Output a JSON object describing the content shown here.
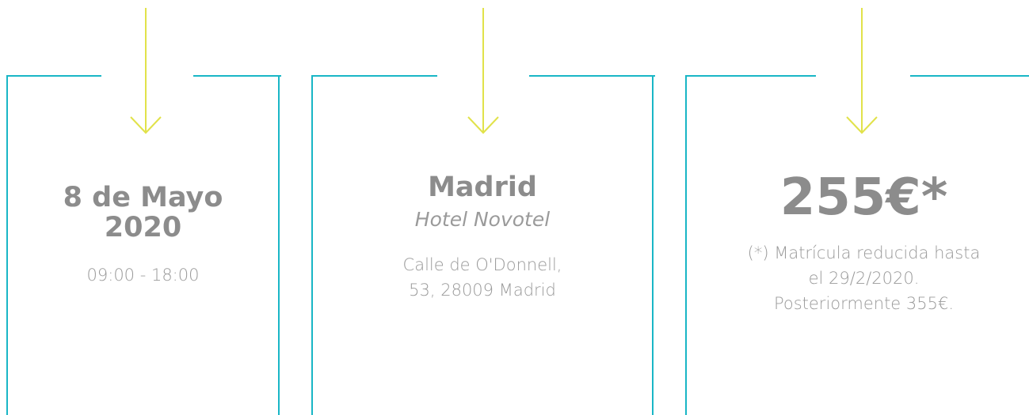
{
  "colors": {
    "frame": "#19b6c6",
    "arrow": "#e1e24a",
    "heading": "#8c8c8c",
    "text": "#9a9a9a"
  },
  "cards": [
    {
      "heading_line1": "8 de Mayo",
      "heading_line2": "2020",
      "time": "09:00 - 18:00",
      "icon": "arrow-down-icon"
    },
    {
      "heading": "Madrid",
      "venue": "Hotel Novotel",
      "address_line1": "Calle de O'Donnell,",
      "address_line2": "53, 28009 Madrid",
      "icon": "arrow-down-icon"
    },
    {
      "heading": "255€*",
      "note_line1": "(*) Matrícula reducida hasta",
      "note_line2": "el 29/2/2020.",
      "note_line3": "Posteriormente 355€.",
      "icon": "arrow-down-icon"
    }
  ]
}
